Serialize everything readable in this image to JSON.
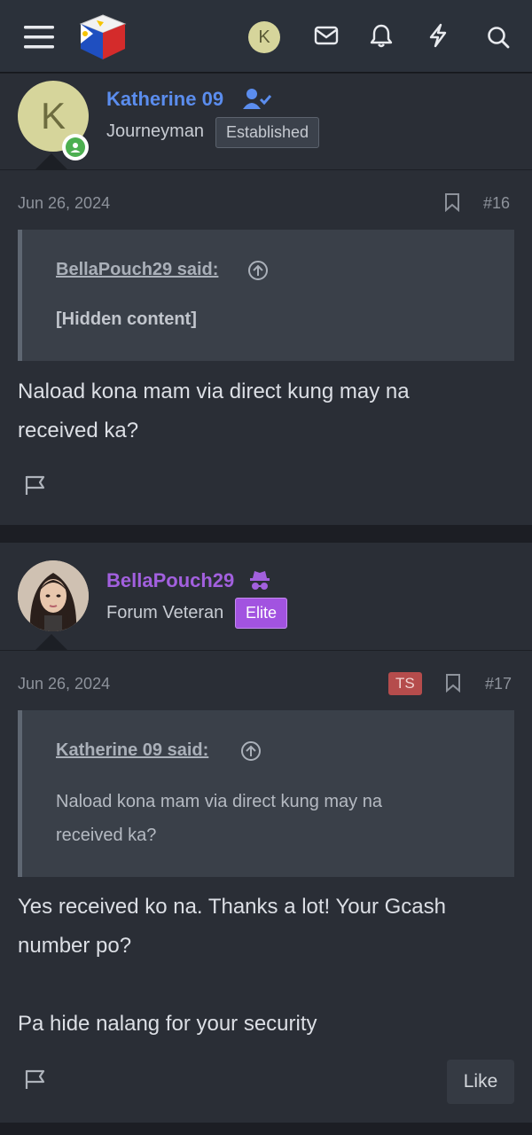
{
  "header": {
    "menu_icon": "hamburger-icon",
    "logo_icon": "philippine-flag-cube-logo",
    "account_initial": "K",
    "icons": [
      "mail-icon",
      "bell-icon",
      "lightning-icon",
      "search-icon"
    ]
  },
  "posts": [
    {
      "user": {
        "avatar_initial": "K",
        "name": "Katherine 09",
        "name_color": "#5b8dee",
        "title": "Journeyman",
        "badge": "Established",
        "online": true
      },
      "date": "Jun 26, 2024",
      "number": "#16",
      "quote": {
        "author": "BellaPouch29 said:",
        "body": "[Hidden content]"
      },
      "text_line1": "Naload kona mam via direct kung may na",
      "text_line2": "received ka?"
    },
    {
      "user": {
        "name": "BellaPouch29",
        "name_color": "#a260de",
        "title": "Forum Veteran",
        "badge": "Elite"
      },
      "date": "Jun 26, 2024",
      "ts_label": "TS",
      "number": "#17",
      "quote": {
        "author": "Katherine 09 said:",
        "body_line1": "Naload kona mam via direct kung may na",
        "body_line2": "received ka?"
      },
      "text_line1": "Yes received ko na. Thanks a lot! Your Gcash",
      "text_line2": "number po?",
      "text_line3": "Pa hide nalang for your security",
      "like_label": "Like"
    }
  ]
}
